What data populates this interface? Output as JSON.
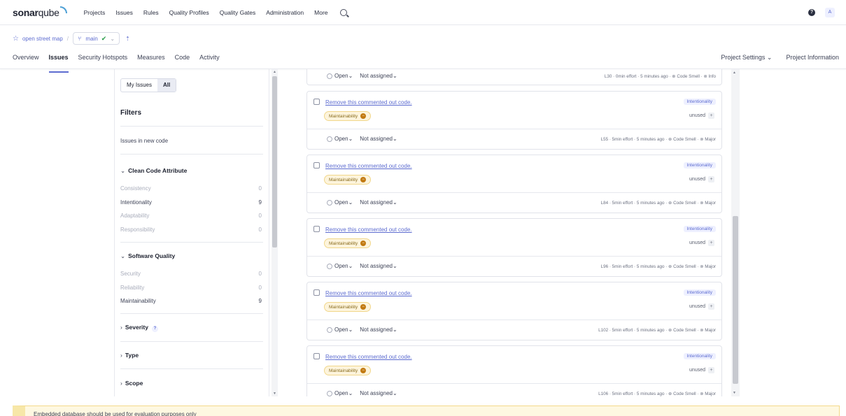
{
  "nav": {
    "logo_bold": "sonar",
    "logo_light": "qube",
    "links": [
      "Projects",
      "Issues",
      "Rules",
      "Quality Profiles",
      "Quality Gates",
      "Administration",
      "More"
    ],
    "avatar": "A"
  },
  "breadcrumb": {
    "project": "open street map",
    "separator": "/",
    "branch": "main"
  },
  "tabs": [
    "Overview",
    "Issues",
    "Security Hotspots",
    "Measures",
    "Code",
    "Activity"
  ],
  "project_links": [
    "Project Settings ⌄",
    "Project Information"
  ],
  "filters": {
    "my_issues": "My Issues",
    "all": "All",
    "title": "Filters",
    "new_code": "Issues in new code",
    "clean_code": {
      "heading": "Clean Code Attribute",
      "rows": [
        {
          "label": "Consistency",
          "count": "0"
        },
        {
          "label": "Intentionality",
          "count": "9"
        },
        {
          "label": "Adaptability",
          "count": "0"
        },
        {
          "label": "Responsibility",
          "count": "0"
        }
      ]
    },
    "software_quality": {
      "heading": "Software Quality",
      "rows": [
        {
          "label": "Security",
          "count": "0"
        },
        {
          "label": "Reliability",
          "count": "0"
        },
        {
          "label": "Maintainability",
          "count": "9"
        }
      ]
    },
    "severity": "Severity",
    "type": "Type",
    "scope": "Scope"
  },
  "issues": {
    "top_partial": {
      "status": "Open",
      "assignee": "Not assigned",
      "meta": "L30 · 0min effort · 5 minutes ago · ⊛ Code Smell · ⊚ Info"
    },
    "cards": [
      {
        "title": "Remove this commented out code.",
        "attribute": "Intentionality",
        "quality": "Maintainability",
        "tag": "unused",
        "status": "Open",
        "assignee": "Not assigned",
        "meta": "L55 · 5min effort · 5 minutes ago · ⊛ Code Smell · ⊚ Major"
      },
      {
        "title": "Remove this commented out code.",
        "attribute": "Intentionality",
        "quality": "Maintainability",
        "tag": "unused",
        "status": "Open",
        "assignee": "Not assigned",
        "meta": "L84 · 5min effort · 5 minutes ago · ⊛ Code Smell · ⊚ Major"
      },
      {
        "title": "Remove this commented out code.",
        "attribute": "Intentionality",
        "quality": "Maintainability",
        "tag": "unused",
        "status": "Open",
        "assignee": "Not assigned",
        "meta": "L96 · 5min effort · 5 minutes ago · ⊛ Code Smell · ⊚ Major"
      },
      {
        "title": "Remove this commented out code.",
        "attribute": "Intentionality",
        "quality": "Maintainability",
        "tag": "unused",
        "status": "Open",
        "assignee": "Not assigned",
        "meta": "L102 · 5min effort · 5 minutes ago · ⊛ Code Smell · ⊚ Major"
      },
      {
        "title": "Remove this commented out code.",
        "attribute": "Intentionality",
        "quality": "Maintainability",
        "tag": "unused",
        "status": "Open",
        "assignee": "Not assigned",
        "meta": "L106 · 5min effort · 5 minutes ago · ⊛ Code Smell · ⊚ Major"
      }
    ]
  },
  "warning": "Embedded database should be used for evaluation purposes only",
  "icons": {
    "search": "search-icon",
    "help": "help-icon",
    "star": "star-icon",
    "branch": "branch-icon",
    "check": "check-icon"
  },
  "colors": {
    "accent": "#5d6cd0",
    "maintainability_badge": "#fdf4dc",
    "warning_bg": "#fef8e1"
  }
}
